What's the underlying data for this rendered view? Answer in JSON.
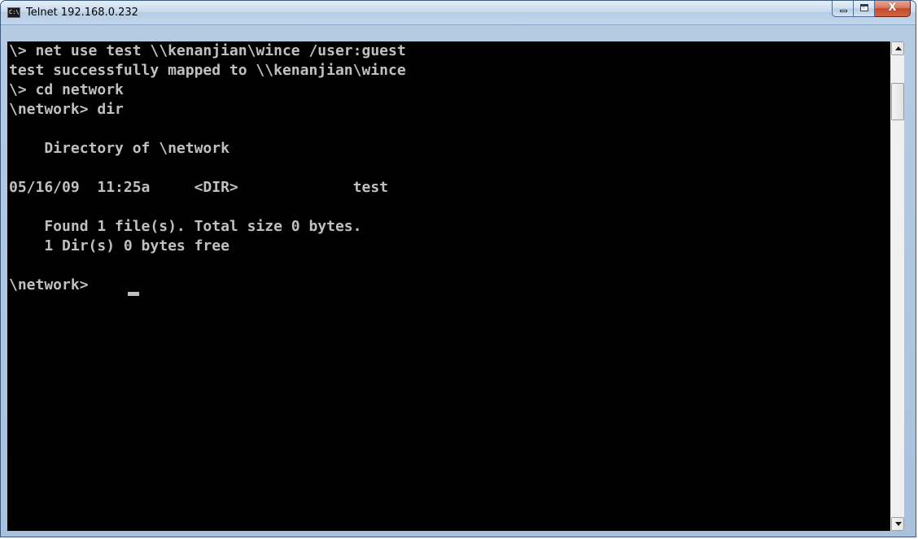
{
  "window": {
    "title": "Telnet 192.168.0.232",
    "icon_text": "C:\\",
    "icon": "console-app-icon",
    "controls": {
      "minimize_icon": "minimize-icon",
      "maximize_icon": "maximize-icon",
      "close_icon": "close-icon",
      "close_glyph": "X"
    }
  },
  "console": {
    "lines": [
      "\\> net use test \\\\kenanjian\\wince /user:guest",
      "test successfully mapped to \\\\kenanjian\\wince",
      "\\> cd network",
      "\\network> dir",
      "",
      "    Directory of \\network",
      "",
      "05/16/09  11:25a     <DIR>             test",
      "",
      "    Found 1 file(s). Total size 0 bytes.",
      "    1 Dir(s) 0 bytes free",
      "",
      "\\network> "
    ],
    "text_color": "#c0c0c0",
    "background_color": "#000000"
  },
  "scrollbar": {
    "up_icon": "scroll-up-arrow-icon",
    "down_icon": "scroll-down-arrow-icon"
  },
  "colors": {
    "title_bar": "#c9dbee",
    "close_button": "#c54a2c",
    "frame_border": "#3b5a82"
  }
}
